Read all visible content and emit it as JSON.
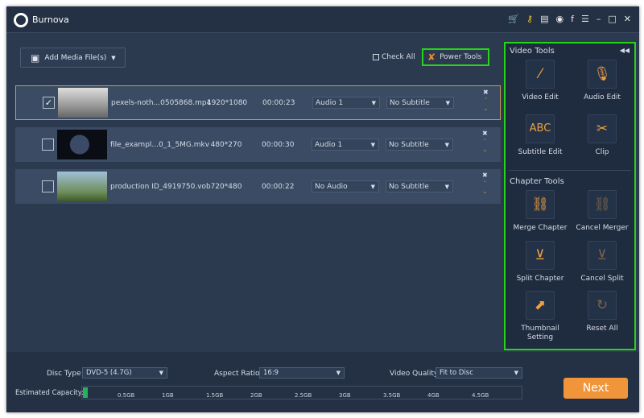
{
  "app": {
    "title": "Burnova",
    "title_icons": [
      "cart-icon",
      "key-icon",
      "document-icon",
      "help-icon",
      "facebook-icon",
      "feedback-icon",
      "minimize-icon",
      "maximize-icon",
      "close-icon"
    ]
  },
  "toolbar": {
    "add_media": "Add Media File(s)",
    "check_all": "Check All",
    "power_tools": "Power Tools"
  },
  "files": [
    {
      "checked": true,
      "name": "pexels-noth...0505868.mp4",
      "resolution": "1920*1080",
      "duration": "00:00:23",
      "audio": "Audio 1",
      "subtitle": "No Subtitle"
    },
    {
      "checked": false,
      "name": "file_exampl...0_1_5MG.mkv",
      "resolution": "480*270",
      "duration": "00:00:30",
      "audio": "Audio 1",
      "subtitle": "No Subtitle"
    },
    {
      "checked": false,
      "name": "production ID_4919750.vob",
      "resolution": "720*480",
      "duration": "00:00:22",
      "audio": "No Audio",
      "subtitle": "No Subtitle"
    }
  ],
  "side": {
    "video_tools": "Video Tools",
    "chapter_tools": "Chapter Tools",
    "tools": [
      {
        "label": "Video Edit",
        "icon": "magic-wand-icon"
      },
      {
        "label": "Audio Edit",
        "icon": "microphone-icon"
      },
      {
        "label": "Subtitle Edit",
        "icon": "abc-icon"
      },
      {
        "label": "Clip",
        "icon": "scissors-icon"
      },
      {
        "label": "Merge Chapter",
        "icon": "link-icon"
      },
      {
        "label": "Cancel Merger",
        "icon": "broken-link-icon"
      },
      {
        "label": "Split Chapter",
        "icon": "split-icon"
      },
      {
        "label": "Cancel Split",
        "icon": "cancel-split-icon"
      },
      {
        "label": "Thumbnail Setting",
        "icon": "thumbnail-icon"
      },
      {
        "label": "Reset All",
        "icon": "reset-icon"
      }
    ]
  },
  "bottom": {
    "disc_type_label": "Disc Type",
    "disc_type": "DVD-5 (4.7G)",
    "aspect_label": "Aspect Ratio:",
    "aspect": "16:9",
    "quality_label": "Video Quality:",
    "quality": "Fit to Disc",
    "capacity_label": "Estimated Capacity:",
    "capacity_ticks": [
      "0.5GB",
      "1GB",
      "1.5GB",
      "2GB",
      "2.5GB",
      "3GB",
      "3.5GB",
      "4GB",
      "4.5GB"
    ],
    "next": "Next"
  },
  "colors": {
    "accent": "#f1953a",
    "highlight": "#28d418",
    "capacity_fill": "#23b35c"
  }
}
